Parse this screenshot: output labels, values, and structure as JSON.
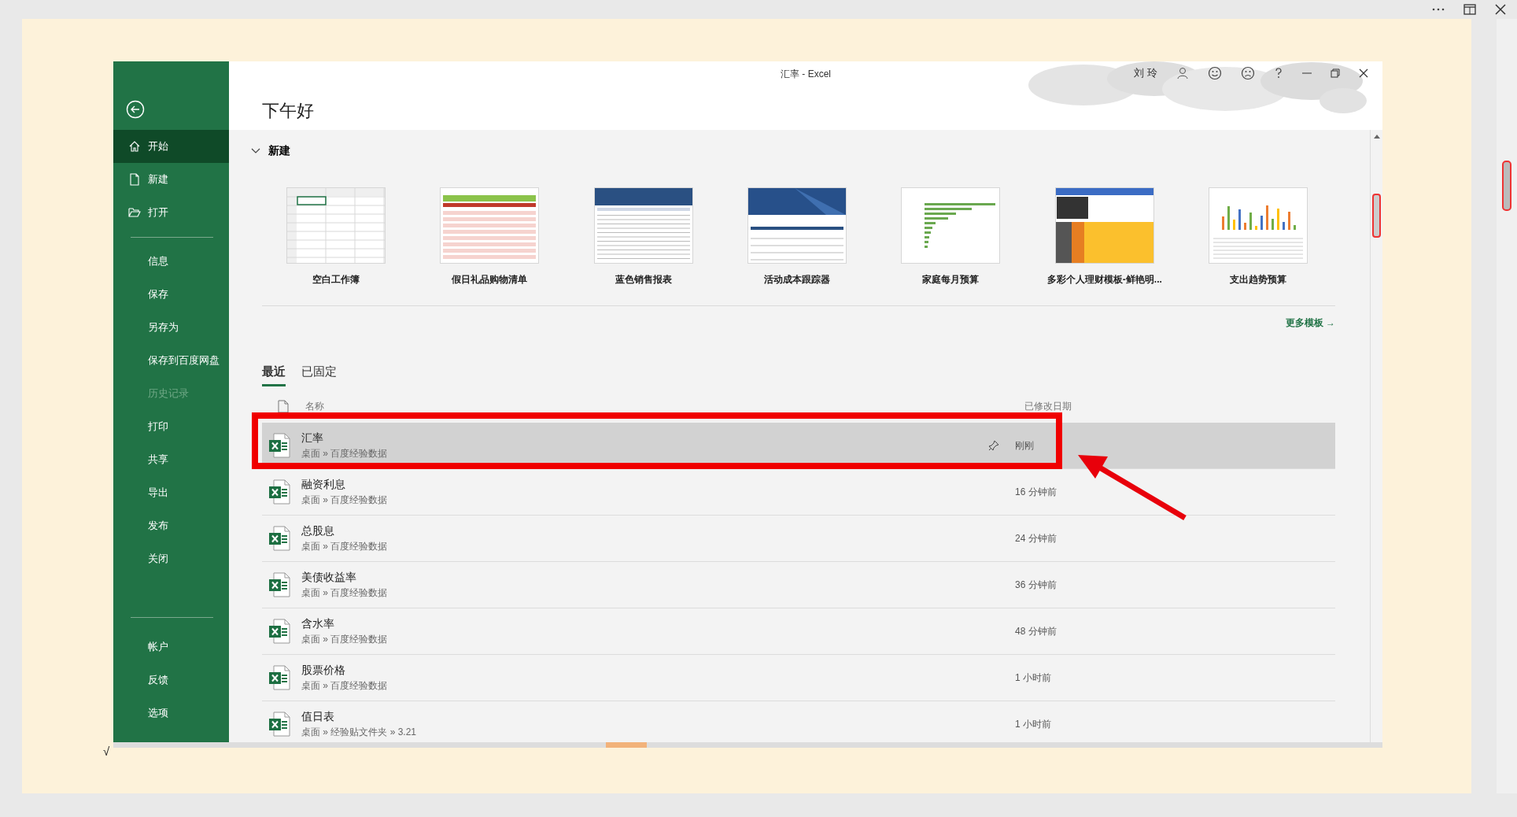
{
  "window": {
    "title": "汇率  -  Excel",
    "user": "刘 玲"
  },
  "sidebar": {
    "groups": [
      [
        {
          "label": "开始",
          "kind": "home",
          "selected": true,
          "disabled": false
        },
        {
          "label": "新建",
          "kind": "file",
          "selected": false,
          "disabled": false
        },
        {
          "label": "打开",
          "kind": "folder",
          "selected": false,
          "disabled": false
        }
      ],
      [
        {
          "label": "信息",
          "kind": "plain",
          "selected": false,
          "disabled": false
        },
        {
          "label": "保存",
          "kind": "plain",
          "selected": false,
          "disabled": false
        },
        {
          "label": "另存为",
          "kind": "plain",
          "selected": false,
          "disabled": false
        },
        {
          "label": "保存到百度网盘",
          "kind": "plain",
          "selected": false,
          "disabled": false
        },
        {
          "label": "历史记录",
          "kind": "plain",
          "selected": false,
          "disabled": true
        },
        {
          "label": "打印",
          "kind": "plain",
          "selected": false,
          "disabled": false
        },
        {
          "label": "共享",
          "kind": "plain",
          "selected": false,
          "disabled": false
        },
        {
          "label": "导出",
          "kind": "plain",
          "selected": false,
          "disabled": false
        },
        {
          "label": "发布",
          "kind": "plain",
          "selected": false,
          "disabled": false
        },
        {
          "label": "关闭",
          "kind": "plain",
          "selected": false,
          "disabled": false
        }
      ],
      [
        {
          "label": "帐户",
          "kind": "plain",
          "selected": false,
          "disabled": false
        },
        {
          "label": "反馈",
          "kind": "plain",
          "selected": false,
          "disabled": false
        },
        {
          "label": "选项",
          "kind": "plain",
          "selected": false,
          "disabled": false
        }
      ]
    ]
  },
  "greeting": "下午好",
  "new_section": {
    "title": "新建",
    "expanded": true,
    "templates": [
      {
        "label": "空白工作簿",
        "kind": "blank"
      },
      {
        "label": "假日礼品购物清单",
        "kind": "list"
      },
      {
        "label": "蓝色销售报表",
        "kind": "table"
      },
      {
        "label": "活动成本跟踪器",
        "kind": "tracker"
      },
      {
        "label": "家庭每月预算",
        "kind": "bars"
      },
      {
        "label": "多彩个人理财模板-鲜艳明...",
        "kind": "colorful"
      },
      {
        "label": "支出趋势预算",
        "kind": "chart"
      }
    ],
    "more_link": "更多模板 →"
  },
  "recent": {
    "tabs": [
      {
        "label": "最近",
        "selected": true
      },
      {
        "label": "已固定",
        "selected": false
      }
    ],
    "columns": [
      "名称",
      "已修改日期"
    ],
    "files": [
      {
        "name": "汇率",
        "path": "桌面 » 百度经验数据",
        "modified": "刚刚",
        "selected": true
      },
      {
        "name": "融资利息",
        "path": "桌面 » 百度经验数据",
        "modified": "16 分钟前",
        "selected": false
      },
      {
        "name": "总股息",
        "path": "桌面 » 百度经验数据",
        "modified": "24 分钟前",
        "selected": false
      },
      {
        "name": "美债收益率",
        "path": "桌面 » 百度经验数据",
        "modified": "36 分钟前",
        "selected": false
      },
      {
        "name": "含水率",
        "path": "桌面 » 百度经验数据",
        "modified": "48 分钟前",
        "selected": false
      },
      {
        "name": "股票价格",
        "path": "桌面 » 百度经验数据",
        "modified": "1 小时前",
        "selected": false
      },
      {
        "name": "值日表",
        "path": "桌面 » 经验贴文件夹 » 3.21",
        "modified": "1 小时前",
        "selected": false
      }
    ]
  },
  "page_mark": "√"
}
